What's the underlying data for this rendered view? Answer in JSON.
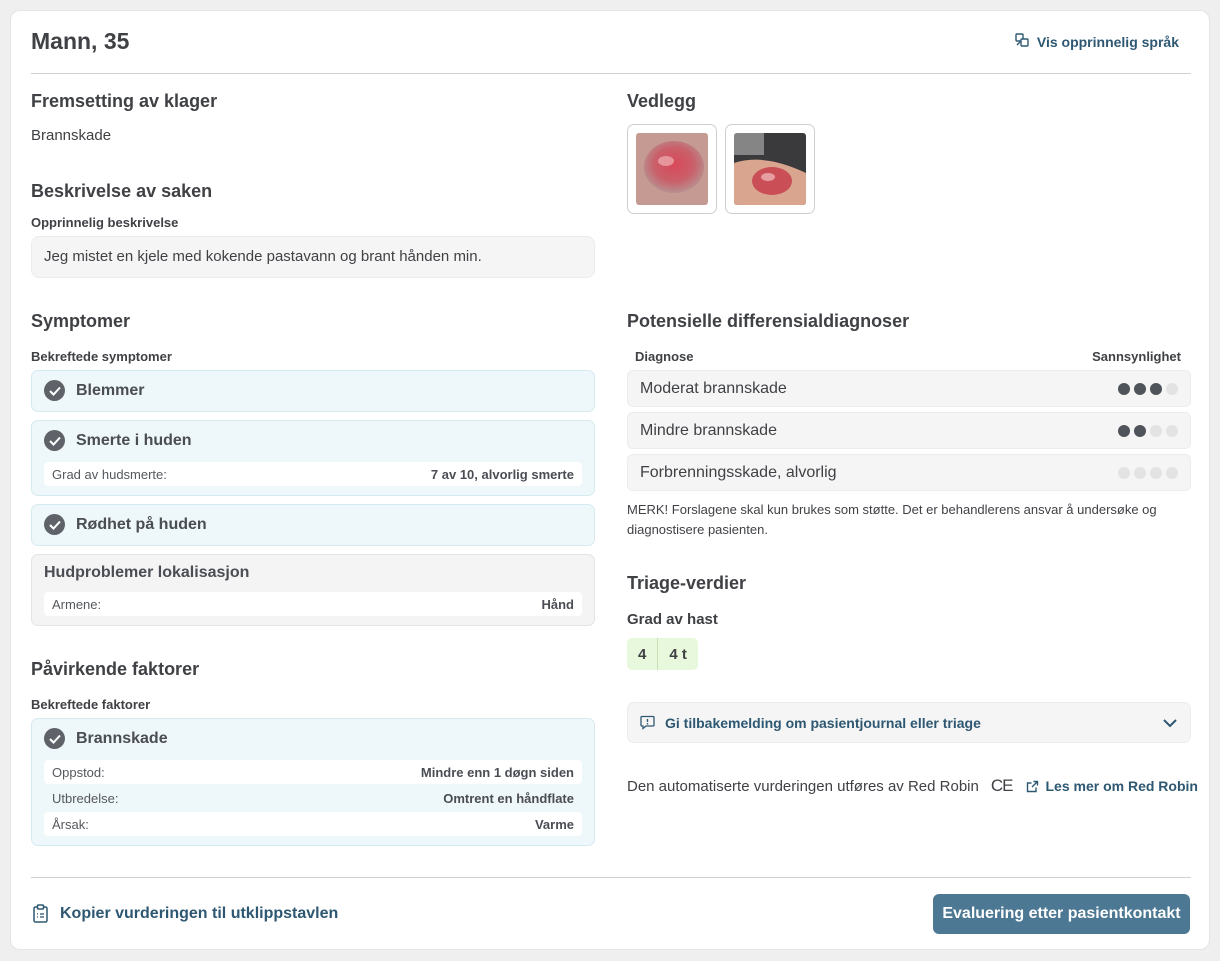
{
  "header": {
    "title": "Mann, 35",
    "lang_button": "Vis opprinnelig språk"
  },
  "complaint": {
    "heading": "Fremsetting av klager",
    "value": "Brannskade"
  },
  "description": {
    "heading": "Beskrivelse av saken",
    "sublabel": "Opprinnelig beskrivelse",
    "text": "Jeg mistet en kjele med kokende pastavann og brant hånden min."
  },
  "attachments": {
    "heading": "Vedlegg"
  },
  "symptoms": {
    "heading": "Symptomer",
    "sublabel": "Bekreftede symptomer",
    "items": [
      {
        "label": "Blemmer"
      },
      {
        "label": "Smerte i huden",
        "detail_key": "Grad av hudsmerte:",
        "detail_value": "7 av 10, alvorlig smerte"
      },
      {
        "label": "Rødhet på huden"
      }
    ],
    "location": {
      "label": "Hudproblemer lokalisasjon",
      "detail_key": "Armene:",
      "detail_value": "Hånd"
    }
  },
  "factors": {
    "heading": "Påvirkende faktorer",
    "sublabel": "Bekreftede faktorer",
    "item": {
      "label": "Brannskade",
      "details": [
        {
          "k": "Oppstod:",
          "v": "Mindre enn 1 døgn siden"
        },
        {
          "k": "Utbredelse:",
          "v": "Omtrent en håndflate"
        },
        {
          "k": "Årsak:",
          "v": "Varme"
        }
      ]
    }
  },
  "diagnoses": {
    "heading": "Potensielle differensialdiagnoser",
    "col_diagnosis": "Diagnose",
    "col_probability": "Sannsynlighet",
    "rows": [
      {
        "name": "Moderat brannskade",
        "probability": 3,
        "max": 4
      },
      {
        "name": "Mindre brannskade",
        "probability": 2,
        "max": 4
      },
      {
        "name": "Forbrenningsskade, alvorlig",
        "probability": 0,
        "max": 4
      }
    ],
    "note": "MERK! Forslagene skal kun brukes som støtte. Det er behandlerens ansvar å undersøke og diagnostisere pasienten."
  },
  "triage": {
    "heading": "Triage-verdier",
    "sublabel": "Grad av hast",
    "level": "4",
    "time": "4 t"
  },
  "feedback": {
    "label": "Gi tilbakemelding om pasientjournal eller triage"
  },
  "footer_info": {
    "text": "Den automatiserte vurderingen utføres av Red Robin",
    "ce_mark": "CE",
    "link": "Les mer om Red Robin"
  },
  "actions": {
    "copy": "Kopier vurderingen til utklippstavlen",
    "evaluate": "Evaluering etter pasientkontakt"
  },
  "colors": {
    "accent": "#2e5872",
    "button": "#4d7893",
    "triage_bg": "#e7f8dc",
    "symptom_bg": "#eef7f9"
  }
}
